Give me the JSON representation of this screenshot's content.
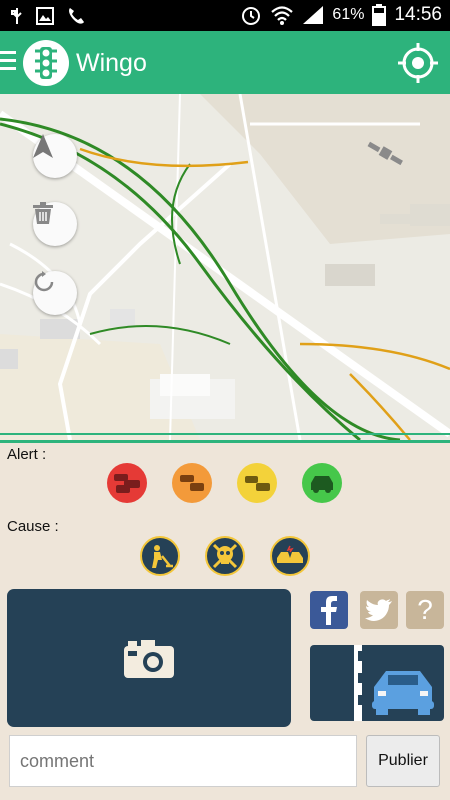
{
  "status_bar": {
    "battery": "61%",
    "time": "14:56",
    "icons": [
      "usb-icon",
      "image-icon",
      "phone-icon",
      "alarm-icon",
      "wifi-icon",
      "signal-icon",
      "battery-icon"
    ]
  },
  "app_bar": {
    "title": "Wingo",
    "menu_icon": "hamburger-menu-icon",
    "logo_icon": "traffic-light-icon",
    "action_icon": "gps-locate-icon"
  },
  "map": {
    "controls": [
      {
        "name": "compass-button",
        "icon": "navigation-arrow-icon"
      },
      {
        "name": "delete-button",
        "icon": "trash-icon"
      },
      {
        "name": "refresh-button",
        "icon": "refresh-icon"
      }
    ],
    "gps_icon": "satellite-icon"
  },
  "alert": {
    "label": "Alert :",
    "levels": [
      {
        "name": "red",
        "color": "#e53a36"
      },
      {
        "name": "orange",
        "color": "#f39a3a"
      },
      {
        "name": "yellow",
        "color": "#f3d23a"
      },
      {
        "name": "green",
        "color": "#46c74a"
      }
    ]
  },
  "cause": {
    "label": "Cause :",
    "items": [
      "roadwork-icon",
      "danger-skull-icon",
      "accident-icon"
    ]
  },
  "colors": {
    "accent": "#2db37c",
    "panel": "#254156",
    "background": "#eee5d9"
  },
  "comment": {
    "placeholder": "comment",
    "value": ""
  },
  "publish_label": "Publier",
  "help_label": "?"
}
